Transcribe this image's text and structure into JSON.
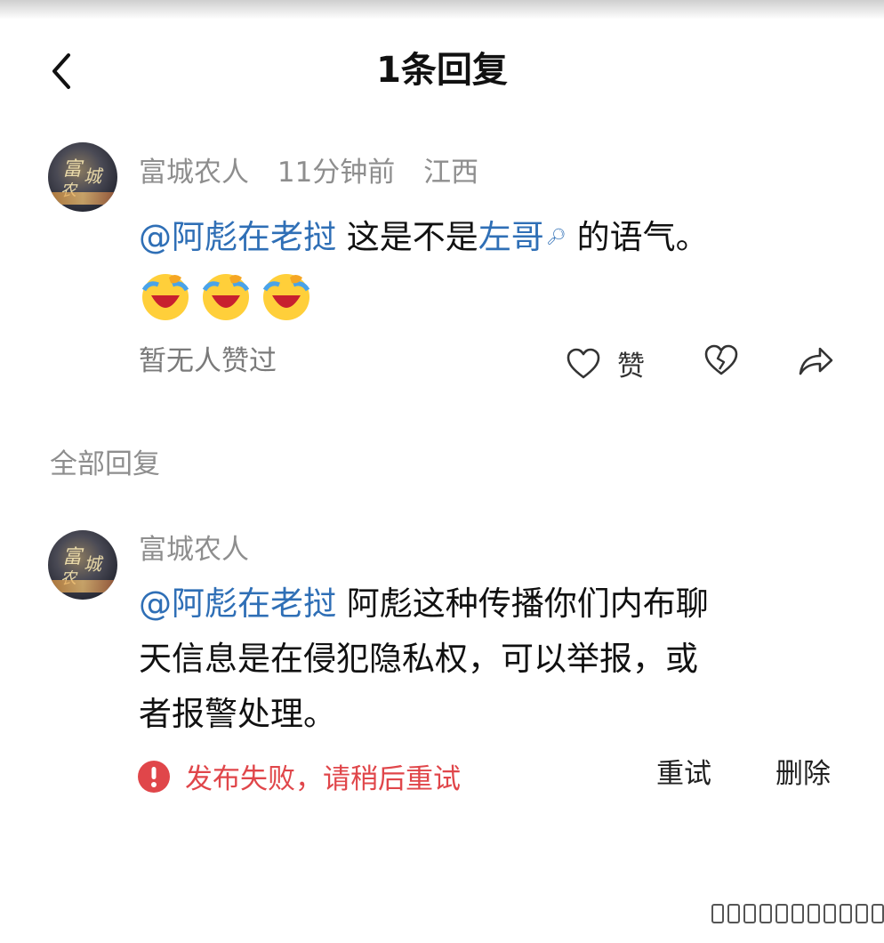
{
  "header": {
    "title": "1条回复"
  },
  "comment": {
    "author": "富城农人",
    "time": "11分钟前",
    "location": "江西",
    "mention": "@阿彪在老挝",
    "text_part1": "这是不是",
    "topic": "左哥",
    "text_part2": "的语气。",
    "emojis": [
      "face-with-tears-of-joy-icon",
      "face-with-tears-of-joy-icon",
      "face-with-tears-of-joy-icon"
    ],
    "likes_text": "暂无人赞过",
    "like_label": "赞"
  },
  "replies_section": {
    "title": "全部回复"
  },
  "reply": {
    "author": "富城农人",
    "mention": "@阿彪在老挝",
    "line1": "阿彪这种传播你们内布聊",
    "line2": "天信息是在侵犯隐私权，可以举报，或",
    "line3": "者报警处理。",
    "fail_text": "发布失败，请稍后重试",
    "retry_label": "重试",
    "delete_label": "删除"
  },
  "colors": {
    "mention": "#2f6fb6",
    "error": "#e0464a",
    "muted": "#8e8e8e"
  }
}
